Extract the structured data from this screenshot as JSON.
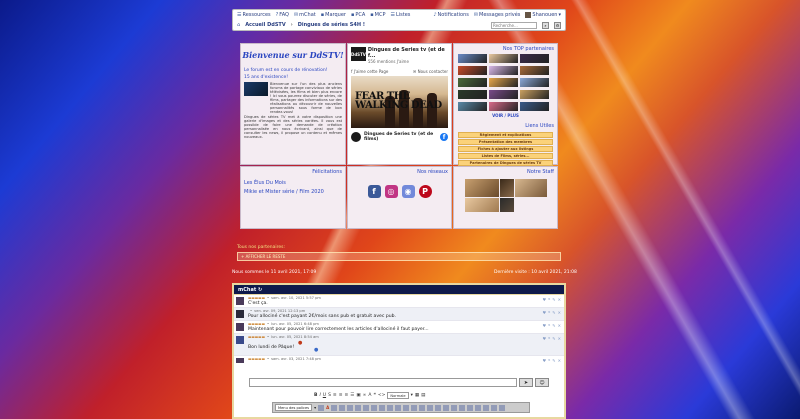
{
  "navbar": {
    "links": [
      {
        "label": "Ressources",
        "icon": "list-icon"
      },
      {
        "label": "FAQ",
        "icon": "help-icon"
      },
      {
        "label": "mChat",
        "icon": "chat-icon"
      },
      {
        "label": "Marquer",
        "icon": "bookmark-icon"
      },
      {
        "label": "PCA",
        "icon": "pca-icon"
      },
      {
        "label": "MCP",
        "icon": "mcp-icon"
      },
      {
        "label": "Listes",
        "icon": "list-icon"
      }
    ],
    "notifications": "Notifications",
    "messages": "Messages privés",
    "user": "Shanouen",
    "breadcrumb": [
      "Accueil DdSTV",
      "Dingues de séries S4H !"
    ],
    "search_placeholder": "Recherche..."
  },
  "welcome": {
    "title": "Bienvenue sur DdSTV!",
    "subtitle": "Le forum est en cours de rénovation!",
    "since": "15 ans d'existence!",
    "paragraph1": "Bienvenue sur l'un des plus anciens forums de partage conviviaux de séries télévisées, les films et bien plus encore ! Ici vous pourrez discuter de séries, de films, partager des informations sur des réalisations ou découvrir de nouvelles personnalités sous forme de bon rendez-vous!",
    "paragraph2": "Dingues de séries TV met à votre disposition une galerie d'images et des séries variées. Il vous est possible de faire une demande de création personnalisée en nous écrivant, ainsi que de consulter les news, il propose un contenu et mêmes nouveaux."
  },
  "facebook": {
    "logo": "DdSTV",
    "page_name": "Dingues de Series tv (et de f...",
    "followers": "556 mentions J'aime",
    "like_page": "J'aime cette Page",
    "contact": "Nous contacter",
    "image_text": "FEAR THE WALKING DEAD",
    "footer_name": "Dingues de Series tv (et de films)"
  },
  "partners": {
    "title": "Nos TOP partenaires",
    "more": "VOIR / PLUS",
    "colors": [
      "#6a8ac8",
      "#e8c8a0",
      "#3a2a4a",
      "#c84a2a",
      "#d8b8e8",
      "#a86a3a",
      "#4a6a3a",
      "#e8a84a",
      "#8aa8d8",
      "#2a3a2a",
      "#7a4a8a",
      "#caa060",
      "#5a8aa8",
      "#d86a8a",
      "#3a5a8a"
    ]
  },
  "useful_links": {
    "title": "Liens Utiles",
    "items": [
      "Règlement et explications",
      "Présentation des membres",
      "Fiches à ajouter aux listings",
      "Listes de Films, séries...",
      "Partenaires de Dingues de séries TV"
    ]
  },
  "favorites": {
    "title": "Félicitations",
    "items": [
      "Les Élus Du Mois",
      "Mikie et Mister série / Film 2020"
    ]
  },
  "social": {
    "title": "Nos réseaux",
    "items": [
      {
        "name": "facebook-icon",
        "glyph": "f",
        "color": "#3b5998"
      },
      {
        "name": "instagram-icon",
        "glyph": "◎",
        "color": "#c13584"
      },
      {
        "name": "discord-icon",
        "glyph": "◉",
        "color": "#7289da"
      },
      {
        "name": "pinterest-icon",
        "glyph": "P",
        "color": "#bd081c"
      }
    ]
  },
  "staff": {
    "title": "Notre Staff"
  },
  "partners_list": {
    "label": "Tous nos partenaires:",
    "button": "+ AFFICHER LE RESTE"
  },
  "dates": {
    "now": "Nous sommes le 11 avril 2021, 17:09",
    "last_visit": "Dernière visite : 10 avril 2021, 21:08"
  },
  "chat": {
    "title": "mChat",
    "messages": [
      {
        "user": "▬▬▬▬▬",
        "time": "sam. avr. 10, 2021 5:57 pm",
        "text": "C'est ça."
      },
      {
        "user": "",
        "time": "ven. avr. 09, 2021 12:13 pm",
        "text": "Pour allociné c'est payant 2€/mois sans pub et gratuit avec pub."
      },
      {
        "user": "▬▬▬▬▬",
        "time": "lun. avr. 05, 2021 6:48 pm",
        "text": "Maintenant pour pouvoir lire correctement les articles d'allociné il faut payer..."
      },
      {
        "user": "▬▬▬▬▬",
        "time": "lun. avr. 05, 2021 8:54 am",
        "text": "Bon lundi de Pâque!"
      },
      {
        "user": "▬▬▬▬▬",
        "time": "sam. avr. 03, 2021 7:48 pm",
        "text": ""
      }
    ],
    "font_select": "Normale",
    "font_family": "Menu des polices"
  }
}
